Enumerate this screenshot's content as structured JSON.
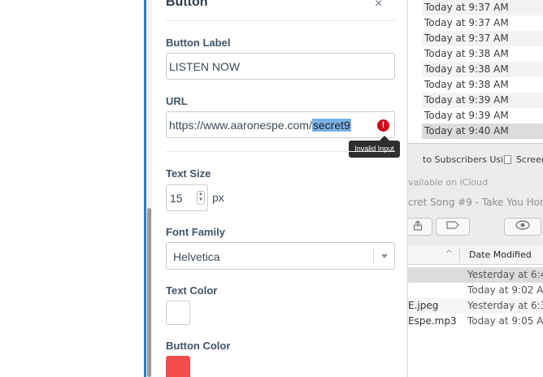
{
  "panel": {
    "title": "Button",
    "close_label": "×",
    "button_label": {
      "label": "Button Label",
      "value": "LISTEN NOW"
    },
    "url": {
      "label": "URL",
      "value_prefix": "https://www.aaronespe.com/",
      "value_selected": "secret9",
      "error_icon": "error-icon",
      "error_glyph": "!",
      "tooltip": "Invalid Input"
    },
    "text_size": {
      "label": "Text Size",
      "value": "15",
      "unit": "px"
    },
    "font_family": {
      "label": "Font Family",
      "value": "Helvetica"
    },
    "text_color": {
      "label": "Text Color",
      "value": "#ffffff"
    },
    "button_color": {
      "label": "Button Color",
      "value": "#f24c4c"
    }
  },
  "finder": {
    "dates": [
      "Today at 9:37 AM",
      "Today at 9:37 AM",
      "Today at 9:37 AM",
      "Today at 9:38 AM",
      "Today at 9:38 AM",
      "Today at 9:38 AM",
      "Today at 9:39 AM",
      "Today at 9:39 AM",
      "Today at 9:40 AM"
    ],
    "path": {
      "crumb1": "to Subscribers Usi",
      "chevron": "›",
      "crumb2": "Screen"
    },
    "icloud": "vailable on iCloud",
    "window_title": "cret Song #9 - Take You Hom",
    "column_header": "Date Modified",
    "sort_glyph": "^",
    "files": [
      {
        "name": "",
        "date": "Yesterday at 6:4"
      },
      {
        "name": "",
        "date": "Today at 9:02 AM"
      },
      {
        "name": "E.jpeg",
        "date": "Yesterday at 6:3"
      },
      {
        "name": "Espe.mp3",
        "date": "Today at 9:05 AM"
      }
    ]
  }
}
